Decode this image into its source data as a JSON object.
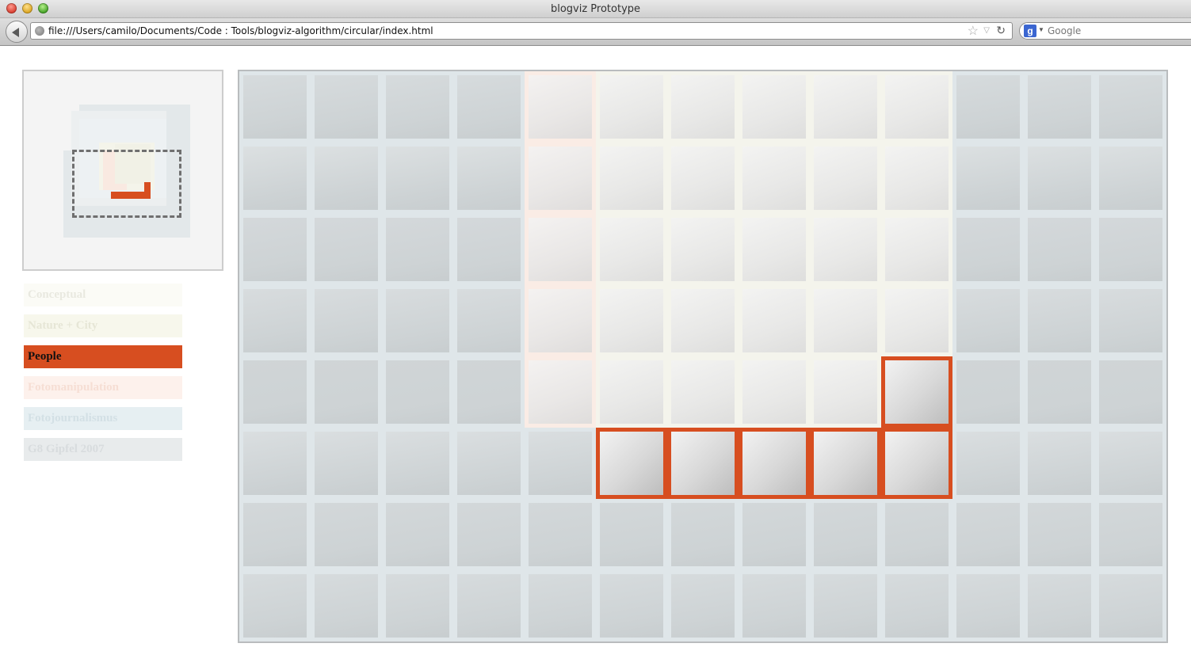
{
  "browser": {
    "window_title": "blogviz Prototype",
    "url": "file:///Users/camilo/Documents/Code : Tools/blogviz-algorithm/circular/index.html",
    "search_placeholder": "Google"
  },
  "categories": [
    {
      "label": "Conceptual",
      "active": false,
      "bg": "#fbfbf6",
      "fg": "#e9e9e0"
    },
    {
      "label": "Nature + City",
      "active": false,
      "bg": "#f7f7ec",
      "fg": "#e6e6d6"
    },
    {
      "label": "People",
      "active": true,
      "bg": "#d74e20",
      "fg": "#111111"
    },
    {
      "label": "Fotomanipulation",
      "active": false,
      "bg": "#fdf1ec",
      "fg": "#f6ded4"
    },
    {
      "label": "Fotojournalismus",
      "active": false,
      "bg": "#e6eff2",
      "fg": "#d3e0e5"
    },
    {
      "label": "G8 Gipfel 2007",
      "active": false,
      "bg": "#e8ebec",
      "fg": "#d8dcde"
    }
  ],
  "colors": {
    "accent": "#d74e20",
    "grid_bg": "#e2e6e8",
    "conceptual": "#f4f4ec",
    "fotomanipulation": "#faece5",
    "fotojournalismus": "#dfe6e9"
  },
  "grid": {
    "columns": 13,
    "rows": 8,
    "regions": [
      "jjjjmmmmmmjjj",
      "jjjjmmmmmmjjj",
      "jjjjmmmmmmjjj",
      "jjjjmmmmmmjjj",
      "jjjjmmmmmpjjj",
      "jjjjjpppppjjj",
      "jjjjjjjjjjjjj",
      "jjjjjjjjjjjjj"
    ]
  }
}
